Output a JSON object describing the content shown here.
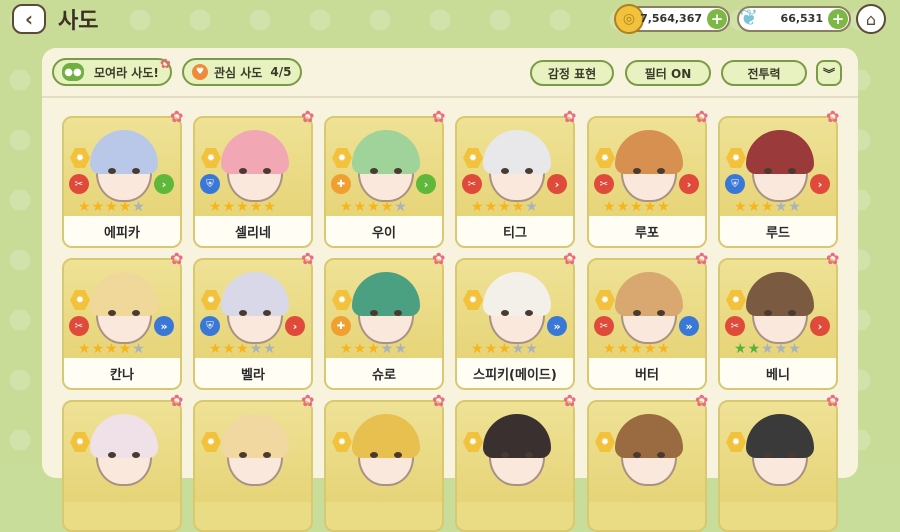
{
  "header": {
    "back_icon": "chevron-left-icon",
    "title": "사도",
    "gold": "7,564,367",
    "gems": "66,531",
    "home_icon": "home-icon"
  },
  "toolbar": {
    "gather_label": "모여라 사도!",
    "favorite_label": "관심 사도",
    "favorite_count": "4/5",
    "emote_label": "감정 표현",
    "filter_label": "필터 ON",
    "power_label": "전투력",
    "expand_icon": "double-chevron-down-icon"
  },
  "characters": [
    {
      "name": "에피카",
      "stars": 4,
      "max": 5,
      "role": "atk",
      "elem": "g",
      "hair": "#b9c8e8"
    },
    {
      "name": "셀리네",
      "stars": 5,
      "max": 5,
      "role": "def",
      "elem": "",
      "hair": "#f2a8b4"
    },
    {
      "name": "우이",
      "stars": 4,
      "max": 5,
      "role": "sup",
      "elem": "g",
      "hair": "#9fd39a"
    },
    {
      "name": "티그",
      "stars": 4,
      "max": 5,
      "role": "atk",
      "elem": "r",
      "hair": "#e8e8ea"
    },
    {
      "name": "루포",
      "stars": 5,
      "max": 5,
      "role": "atk",
      "elem": "r",
      "hair": "#d89050"
    },
    {
      "name": "루드",
      "stars": 3,
      "max": 5,
      "role": "def",
      "elem": "r",
      "hair": "#9a3a3a"
    },
    {
      "name": "칸나",
      "stars": 4,
      "max": 5,
      "role": "atk",
      "elem": "b",
      "hair": "#f0d89a"
    },
    {
      "name": "벨라",
      "stars": 3,
      "max": 5,
      "role": "def",
      "elem": "r",
      "hair": "#d8d8e8"
    },
    {
      "name": "슈로",
      "stars": 3,
      "max": 5,
      "role": "sup",
      "elem": "",
      "hair": "#4aa080"
    },
    {
      "name": "스피키(메이드)",
      "stars": 3,
      "max": 5,
      "role": "",
      "elem": "b",
      "hair": "#f2f0e8"
    },
    {
      "name": "버터",
      "stars": 5,
      "max": 5,
      "role": "atk",
      "elem": "b",
      "hair": "#d8a870"
    },
    {
      "name": "베니",
      "stars": 2,
      "max": 5,
      "role": "atk",
      "elem": "r",
      "hair": "#7a5a40",
      "green": true
    },
    {
      "name": "",
      "stars": 0,
      "max": 0,
      "role": "",
      "elem": "",
      "hair": "#f0e0e8"
    },
    {
      "name": "",
      "stars": 0,
      "max": 0,
      "role": "",
      "elem": "",
      "hair": "#f0d8a0"
    },
    {
      "name": "",
      "stars": 0,
      "max": 0,
      "role": "",
      "elem": "",
      "hair": "#e8c050"
    },
    {
      "name": "",
      "stars": 0,
      "max": 0,
      "role": "",
      "elem": "",
      "hair": "#3a3030"
    },
    {
      "name": "",
      "stars": 0,
      "max": 0,
      "role": "",
      "elem": "",
      "hair": "#9a6a40"
    },
    {
      "name": "",
      "stars": 0,
      "max": 0,
      "role": "",
      "elem": "",
      "hair": "#3a3a3a"
    }
  ]
}
